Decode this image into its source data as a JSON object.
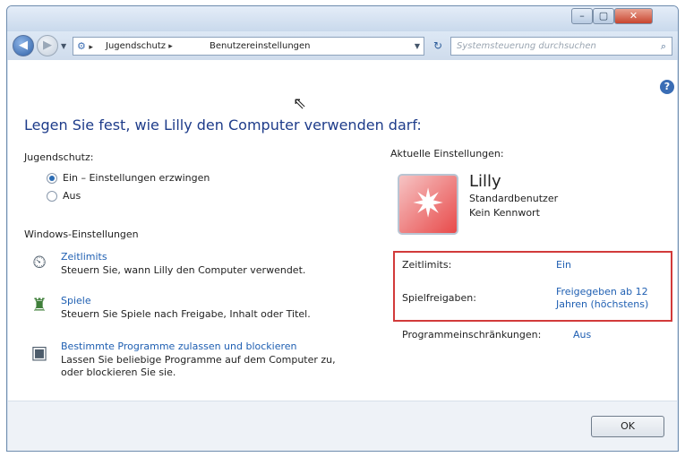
{
  "window": {
    "controls": {
      "minimize": "–",
      "maximize": "▢",
      "close": "✕"
    }
  },
  "nav": {
    "back_icon": "◀",
    "forward_icon": "▶",
    "breadcrumb": [
      "Jugendschutz",
      "Benutzereinstellungen"
    ],
    "search_placeholder": "Systemsteuerung durchsuchen"
  },
  "main": {
    "heading": "Legen Sie fest, wie Lilly den Computer verwenden darf:",
    "jugendschutz": {
      "label": "Jugendschutz:",
      "options": [
        "Ein – Einstellungen erzwingen",
        "Aus"
      ],
      "selected": 0
    },
    "windows_settings": {
      "label": "Windows-Einstellungen",
      "items": [
        {
          "title": "Zeitlimits",
          "desc": "Steuern Sie, wann Lilly den Computer verwendet.",
          "icon": "clock-icon"
        },
        {
          "title": "Spiele",
          "desc": "Steuern Sie Spiele nach Freigabe, Inhalt oder Titel.",
          "icon": "games-icon"
        },
        {
          "title": "Bestimmte Programme zulassen und blockieren",
          "desc": "Lassen Sie beliebige Programme auf dem Computer zu, oder blockieren Sie sie.",
          "icon": "programs-icon"
        }
      ]
    },
    "current": {
      "label": "Aktuelle Einstellungen:",
      "user_name": "Lilly",
      "account_type": "Standardbenutzer",
      "password": "Kein Kennwort",
      "rows": [
        {
          "key": "Zeitlimits:",
          "value": "Ein"
        },
        {
          "key": "Spielfreigaben:",
          "value": "Freigegeben ab 12 Jahren (höchstens)"
        },
        {
          "key": "Programmeinschränkungen:",
          "value": "Aus"
        }
      ]
    }
  },
  "footer": {
    "ok": "OK"
  }
}
